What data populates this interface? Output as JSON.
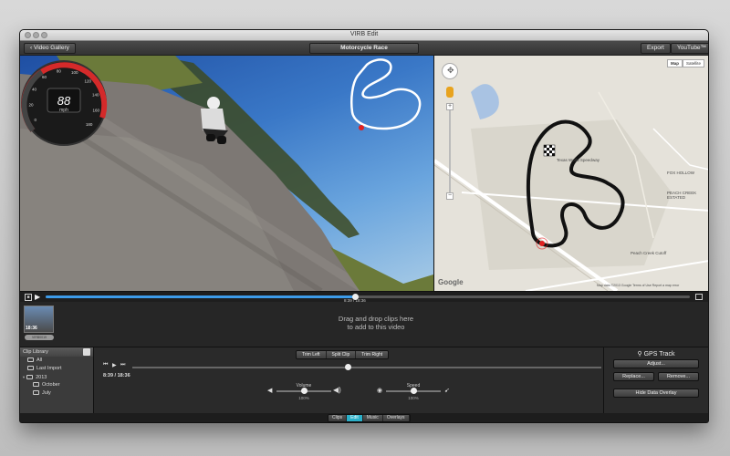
{
  "window": {
    "title": "VIRB Edit"
  },
  "toolbar": {
    "video_gallery": "Video Gallery",
    "project_title": "Motorcycle Race",
    "export": "Export",
    "youtube": "YouTube™"
  },
  "video": {
    "gauge_value": "88",
    "gauge_unit": "mph",
    "gauge_ticks": [
      "0",
      "20",
      "40",
      "60",
      "80",
      "100",
      "120",
      "140",
      "160",
      "180"
    ]
  },
  "map": {
    "type_map": "Map",
    "type_satellite": "Satellite",
    "labels": {
      "speedway": "Texas World Speedway",
      "peach_creek": "PEACH CREEK ESTATED",
      "fox_hollow": "FOX HOLLOW",
      "peach_cutoff": "Peach Creek Cutoff",
      "google": "Google",
      "footer": "Map data ©2013 Google  Terms of Use  Report a map error"
    }
  },
  "playback": {
    "current": "8:39",
    "total": "18:36",
    "separator": " / ",
    "progress": 0.48
  },
  "clips": {
    "thumb_time": "18:36",
    "thumb_name": "VIRB0019",
    "drop_hint_1": "Drag and drop clips here",
    "drop_hint_2": "to add to this video"
  },
  "library": {
    "title": "Clip Library",
    "items": [
      "All",
      "Last Import",
      "2013",
      "October",
      "July"
    ]
  },
  "editor": {
    "trim_left": "Trim Left",
    "split_clip": "Split Clip",
    "trim_right": "Trim Right",
    "clip_time": "8:39 / 18:36",
    "clip_progress": 0.46,
    "volume_label": "Volume",
    "volume_value": "100%",
    "volume_level": 0.5,
    "speed_label": "Speed",
    "speed_value": "100%",
    "speed_level": 0.5
  },
  "gps": {
    "title": "GPS Track",
    "adjust": "Adjust...",
    "replace": "Replace...",
    "remove": "Remove...",
    "hide_overlay": "Hide Data Overlay"
  },
  "tabs": {
    "clips": "Clips",
    "edit": "Edit",
    "music": "Music",
    "overlays": "Overlays",
    "active": "edit"
  },
  "colors": {
    "accent": "#3d9be9",
    "active_tab": "#2bb0c9",
    "gauge_red": "#d42a2a",
    "track": "#111111"
  }
}
